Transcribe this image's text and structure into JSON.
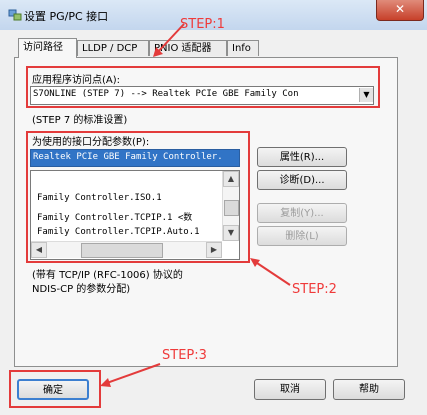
{
  "window": {
    "title": "设置 PG/PC 接口",
    "close_glyph": "✕"
  },
  "tabs": [
    {
      "label": "访问路径",
      "active": true
    },
    {
      "label": "LLDP / DCP"
    },
    {
      "label": "PNIO 适配器"
    },
    {
      "label": "Info"
    }
  ],
  "access_point": {
    "label": "应用程序访问点(A):",
    "value": "S7ONLINE   (STEP 7)       --> Realtek PCIe GBE Family Con",
    "hint": "(STEP 7 的标准设置)"
  },
  "interface": {
    "label": "为使用的接口分配参数(P):",
    "selected": "Realtek PCIe GBE Family Controller.",
    "items": [
      "Family Controller.ISO.1",
      "Family Controller.TCPIP.1  <数",
      "Family Controller.TCPIP.Auto.1"
    ],
    "description_line1": "(带有 TCP/IP (RFC-1006) 协议的",
    "description_line2": "NDIS-CP 的参数分配)"
  },
  "buttons": {
    "properties": "属性(R)...",
    "diagnostics": "诊断(D)...",
    "copy": "复制(Y)...",
    "delete": "删除(L)",
    "ok": "确定",
    "cancel": "取消",
    "help": "帮助"
  },
  "annotations": {
    "step1": "STEP:1",
    "step2": "STEP:2",
    "step3": "STEP:3",
    "color": "#e33b3b"
  }
}
